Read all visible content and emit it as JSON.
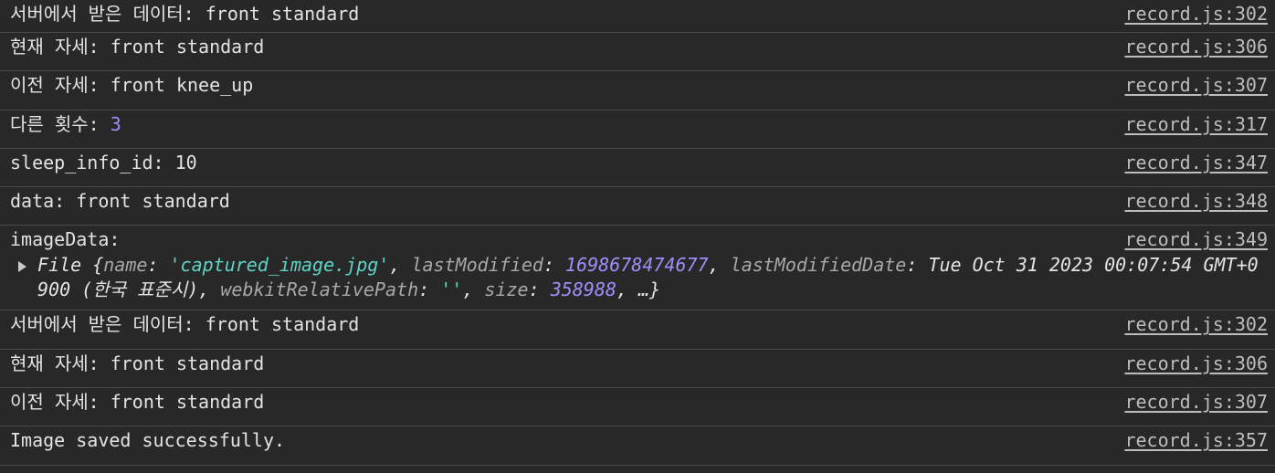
{
  "logs": [
    {
      "text": "서버에서 받은 데이터: front standard",
      "source": "record.js:302"
    },
    {
      "text": "현재 자세: front standard",
      "source": "record.js:306"
    },
    {
      "text": "이전 자세: front knee_up",
      "source": "record.js:307"
    },
    {
      "text_prefix": "다른 횟수: ",
      "number": "3",
      "source": "record.js:317"
    },
    {
      "text": "sleep_info_id: 10",
      "source": "record.js:347"
    },
    {
      "text": "data: front standard",
      "source": "record.js:348"
    },
    {
      "text": "imageData:",
      "source": "record.js:349",
      "object": {
        "type_label": "File {",
        "name_key": "name",
        "name_value": "'captured_image.jpg'",
        "lastModified_key": "lastModified",
        "lastModified_value": "1698678474677",
        "lastModifiedDate_key": "lastModifiedDate",
        "lastModifiedDate_value": "Tue Oct 31 2023 00:07:54 GMT+0900 (한국 표준시)",
        "webkitRelativePath_key": "webkitRelativePath",
        "webkitRelativePath_value": "''",
        "size_key": "size",
        "size_value": "358988",
        "tail": ", …}"
      }
    },
    {
      "text": "서버에서 받은 데이터: front standard",
      "source": "record.js:302"
    },
    {
      "text": "현재 자세: front standard",
      "source": "record.js:306"
    },
    {
      "text": "이전 자세: front standard",
      "source": "record.js:307"
    },
    {
      "text": "Image saved successfully.",
      "source": "record.js:357"
    }
  ],
  "colors": {
    "background": "#282828",
    "text": "#e3e3e3",
    "number": "#9d8ff8",
    "string": "#5fd3c6",
    "key": "#a8a8a8",
    "divider": "#4a4a4a"
  }
}
